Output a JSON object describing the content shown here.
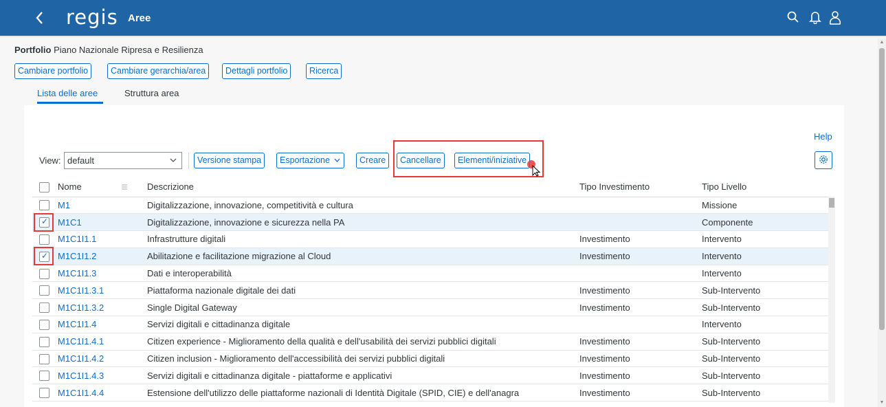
{
  "shell": {
    "logo": "regis",
    "title": "Aree"
  },
  "portfolio": {
    "label": "Portfolio",
    "value": "Piano Nazionale Ripresa e Resilienza"
  },
  "actions": [
    "Cambiare portfolio",
    "Cambiare gerarchia/area",
    "Dettagli portfolio",
    "Ricerca"
  ],
  "tabs": [
    "Lista delle aree",
    "Struttura area"
  ],
  "toolbar": {
    "help": "Help",
    "view_label": "View:",
    "view_value": "default",
    "buttons": [
      "Versione stampa",
      "Esportazione",
      "Creare",
      "Cancellare",
      "Elementi/iniziative"
    ]
  },
  "table": {
    "headers": [
      "Nome",
      "Descrizione",
      "Tipo Investimento",
      "Tipo Livello"
    ],
    "rows": [
      {
        "nome": "M1",
        "descrizione": "Digitalizzazione, innovazione, competitività e cultura",
        "tipo_investimento": "",
        "tipo_livello": "Missione",
        "checked": false
      },
      {
        "nome": "M1C1",
        "descrizione": "Digitalizzazione, innovazione e sicurezza nella PA",
        "tipo_investimento": "",
        "tipo_livello": "Componente",
        "checked": true
      },
      {
        "nome": "M1C1I1.1",
        "descrizione": "Infrastrutture digitali",
        "tipo_investimento": "Investimento",
        "tipo_livello": "Intervento",
        "checked": false
      },
      {
        "nome": "M1C1I1.2",
        "descrizione": "Abilitazione e facilitazione migrazione al Cloud",
        "tipo_investimento": "Investimento",
        "tipo_livello": "Intervento",
        "checked": true
      },
      {
        "nome": "M1C1I1.3",
        "descrizione": "Dati e interoperabilità",
        "tipo_investimento": "",
        "tipo_livello": "Intervento",
        "checked": false
      },
      {
        "nome": "M1C1I1.3.1",
        "descrizione": "Piattaforma nazionale digitale dei dati",
        "tipo_investimento": "Investimento",
        "tipo_livello": "Sub-Intervento",
        "checked": false
      },
      {
        "nome": "M1C1I1.3.2",
        "descrizione": " Single Digital Gateway",
        "tipo_investimento": "Investimento",
        "tipo_livello": "Sub-Intervento",
        "checked": false
      },
      {
        "nome": "M1C1I1.4",
        "descrizione": "Servizi digitali e cittadinanza digitale",
        "tipo_investimento": "",
        "tipo_livello": "Intervento",
        "checked": false
      },
      {
        "nome": "M1C1I1.4.1",
        "descrizione": "Citizen experience - Miglioramento della qualità e dell'usabilità dei servizi pubblici digitali",
        "tipo_investimento": "Investimento",
        "tipo_livello": "Sub-Intervento",
        "checked": false
      },
      {
        "nome": "M1C1I1.4.2",
        "descrizione": "Citizen inclusion - Miglioramento dell'accessibilità dei servizi pubblici digitali",
        "tipo_investimento": "Investimento",
        "tipo_livello": "Sub-Intervento",
        "checked": false
      },
      {
        "nome": "M1C1I1.4.3",
        "descrizione": "Servizi digitali e cittadinanza digitale - piattaforme e applicativi",
        "tipo_investimento": "Investimento",
        "tipo_livello": "Sub-Intervento",
        "checked": false
      },
      {
        "nome": "M1C1I1.4.4",
        "descrizione": " Estensione dell'utilizzo delle piattaforme nazionali di Identità Digitale (SPID, CIE) e dell'anagra",
        "tipo_investimento": "Investimento",
        "tipo_livello": "Sub-Intervento",
        "checked": false
      }
    ]
  },
  "colors": {
    "shellbar": "#1f65a6",
    "accent": "#0a6ed1",
    "highlight": "#e53935"
  }
}
